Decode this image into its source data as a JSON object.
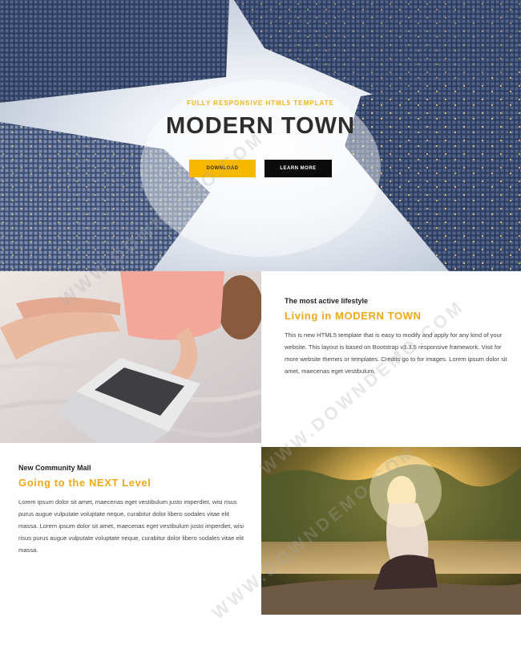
{
  "hero": {
    "subtitle": "FULLY RESPONSIVE HTML5 TEMPLATE",
    "title": "MODERN TOWN",
    "download_label": "DOWNLOAD",
    "learn_more_label": "LEARN MORE"
  },
  "section1": {
    "kicker": "The most active lifestyle",
    "heading": "Living in MODERN TOWN",
    "paragraph": "This is new HTML5 template that is easy to modify and apply for any kind of your website. This layout is based on Bootstrap v3.3.5 responsive framework. Visit for more website themes or templates. Credits go to for images. Lorem ipsum dolor sit amet, maecenas eget vestibulum."
  },
  "section2": {
    "kicker": "New Community Mall",
    "heading": "Going to the NEXT Level",
    "paragraph": "Lorem ipsum dolor sit amet, maecenas eget vestibulum justo imperdiet, wisi risus purus augue vulputate voluptate neque, curabitur dolor libero sodales vitae elit massa. Lorem ipsum dolor sit amet, maecenas eget vestibulum justo imperdiet, wisi risus purus augue vulputate voluptate neque, curabitur dolor libero sodales vitae elit massa."
  },
  "watermark": "WWW.DOWNDEMO.COM",
  "colors": {
    "accent": "#f0a81a",
    "download_button": "#f7b800",
    "learn_more_button": "#0b0b0b"
  }
}
